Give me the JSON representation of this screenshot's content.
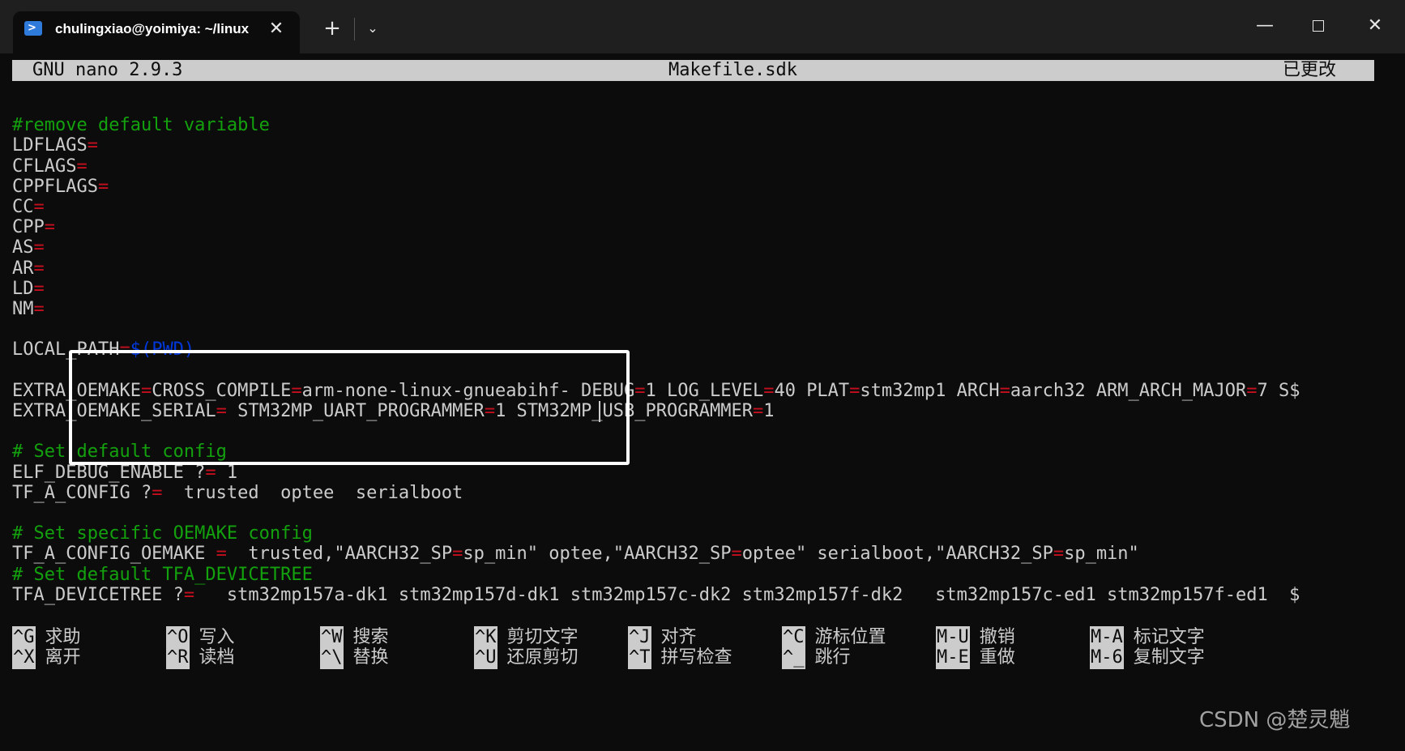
{
  "window": {
    "tab_title": "chulingxiao@yoimiya: ~/linux",
    "tab_close": "✕",
    "new_tab": "+",
    "dropdown": "⌄",
    "minimize": "—",
    "close": "✕"
  },
  "nano": {
    "version": "GNU nano 2.9.3",
    "filename": "Makefile.sdk",
    "status": "已更改"
  },
  "editor": {
    "lines": [
      {
        "segs": []
      },
      {
        "segs": [
          {
            "t": "#remove default variable",
            "c": "cmt"
          }
        ]
      },
      {
        "segs": [
          {
            "t": "LDFLAGS",
            "c": "wt"
          },
          {
            "t": "=",
            "c": "eq"
          }
        ]
      },
      {
        "segs": [
          {
            "t": "CFLAGS",
            "c": "wt"
          },
          {
            "t": "=",
            "c": "eq"
          }
        ]
      },
      {
        "segs": [
          {
            "t": "CPPFLAGS",
            "c": "wt"
          },
          {
            "t": "=",
            "c": "eq"
          }
        ]
      },
      {
        "segs": [
          {
            "t": "CC",
            "c": "wt"
          },
          {
            "t": "=",
            "c": "eq"
          }
        ]
      },
      {
        "segs": [
          {
            "t": "CPP",
            "c": "wt"
          },
          {
            "t": "=",
            "c": "eq"
          }
        ]
      },
      {
        "segs": [
          {
            "t": "AS",
            "c": "wt"
          },
          {
            "t": "=",
            "c": "eq"
          }
        ]
      },
      {
        "segs": [
          {
            "t": "AR",
            "c": "wt"
          },
          {
            "t": "=",
            "c": "eq"
          }
        ]
      },
      {
        "segs": [
          {
            "t": "LD",
            "c": "wt"
          },
          {
            "t": "=",
            "c": "eq"
          }
        ]
      },
      {
        "segs": [
          {
            "t": "NM",
            "c": "wt"
          },
          {
            "t": "=",
            "c": "eq"
          }
        ]
      },
      {
        "segs": []
      },
      {
        "segs": [
          {
            "t": "LOCAL_PATH",
            "c": "wt"
          },
          {
            "t": "=",
            "c": "eq"
          },
          {
            "t": "$(PWD)",
            "c": "var"
          }
        ]
      },
      {
        "segs": []
      },
      {
        "segs": [
          {
            "t": "EXTRA_OEMAKE",
            "c": "wt"
          },
          {
            "t": "=",
            "c": "eq"
          },
          {
            "t": "CROSS_COMPILE",
            "c": "wt"
          },
          {
            "t": "=",
            "c": "eq"
          },
          {
            "t": "arm-none-linux-gnueabihf- DEBUG",
            "c": "wt"
          },
          {
            "t": "=",
            "c": "eq"
          },
          {
            "t": "1 LOG_LEVEL",
            "c": "wt"
          },
          {
            "t": "=",
            "c": "eq"
          },
          {
            "t": "40 PLAT",
            "c": "wt"
          },
          {
            "t": "=",
            "c": "eq"
          },
          {
            "t": "stm32mp1 ARCH",
            "c": "wt"
          },
          {
            "t": "=",
            "c": "eq"
          },
          {
            "t": "aarch32 ARM_ARCH_MAJOR",
            "c": "wt"
          },
          {
            "t": "=",
            "c": "eq"
          },
          {
            "t": "7 S$",
            "c": "wt"
          }
        ]
      },
      {
        "segs": [
          {
            "t": "EXTRA_OEMAKE_SERIAL",
            "c": "wt"
          },
          {
            "t": "=",
            "c": "eq"
          },
          {
            "t": " STM32MP_UART_PROGRAMMER",
            "c": "wt"
          },
          {
            "t": "=",
            "c": "eq"
          },
          {
            "t": "1 STM32MP_USB_PROGRAMMER",
            "c": "wt"
          },
          {
            "t": "=",
            "c": "eq"
          },
          {
            "t": "1",
            "c": "wt"
          }
        ]
      },
      {
        "segs": []
      },
      {
        "segs": [
          {
            "t": "# Set default config",
            "c": "cmt"
          }
        ]
      },
      {
        "segs": [
          {
            "t": "ELF_DEBUG_ENABLE ?",
            "c": "wt"
          },
          {
            "t": "=",
            "c": "eq"
          },
          {
            "t": " 1",
            "c": "wt"
          }
        ]
      },
      {
        "segs": [
          {
            "t": "TF_A_CONFIG ?",
            "c": "wt"
          },
          {
            "t": "=",
            "c": "eq"
          },
          {
            "t": "  trusted  optee  serialboot",
            "c": "wt"
          }
        ]
      },
      {
        "segs": []
      },
      {
        "segs": [
          {
            "t": "# Set specific OEMAKE config",
            "c": "cmt"
          }
        ]
      },
      {
        "segs": [
          {
            "t": "TF_A_CONFIG_OEMAKE ",
            "c": "wt"
          },
          {
            "t": "=",
            "c": "eq"
          },
          {
            "t": "  trusted,\"AARCH32_SP",
            "c": "wt"
          },
          {
            "t": "=",
            "c": "eq"
          },
          {
            "t": "sp_min\" optee,\"AARCH32_SP",
            "c": "wt"
          },
          {
            "t": "=",
            "c": "eq"
          },
          {
            "t": "optee\" serialboot,\"AARCH32_SP",
            "c": "wt"
          },
          {
            "t": "=",
            "c": "eq"
          },
          {
            "t": "sp_min\"",
            "c": "wt"
          }
        ]
      },
      {
        "segs": [
          {
            "t": "# Set default TFA_DEVICETREE",
            "c": "cmt"
          }
        ]
      },
      {
        "segs": [
          {
            "t": "TFA_DEVICETREE ?",
            "c": "wt"
          },
          {
            "t": "=",
            "c": "eq"
          },
          {
            "t": "   stm32mp157a-dk1 stm32mp157d-dk1 stm32mp157c-dk2 stm32mp157f-dk2   stm32mp157c-ed1 stm32mp157f-ed1  $",
            "c": "wt"
          }
        ]
      }
    ]
  },
  "shortcuts": [
    {
      "key": "^G",
      "label": "求助"
    },
    {
      "key": "^O",
      "label": "写入"
    },
    {
      "key": "^W",
      "label": "搜索"
    },
    {
      "key": "^K",
      "label": "剪切文字"
    },
    {
      "key": "^J",
      "label": "对齐"
    },
    {
      "key": "^C",
      "label": "游标位置"
    },
    {
      "key": "M-U",
      "label": "撤销"
    },
    {
      "key": "M-A",
      "label": "标记文字"
    },
    {
      "key": "^X",
      "label": "离开"
    },
    {
      "key": "^R",
      "label": "读档"
    },
    {
      "key": "^\\",
      "label": "替换"
    },
    {
      "key": "^U",
      "label": "还原剪切"
    },
    {
      "key": "^T",
      "label": "拼写检查"
    },
    {
      "key": "^_",
      "label": "跳行"
    },
    {
      "key": "M-E",
      "label": "重做"
    },
    {
      "key": "M-6",
      "label": "复制文字"
    }
  ],
  "watermark": "CSDN @楚灵魈"
}
